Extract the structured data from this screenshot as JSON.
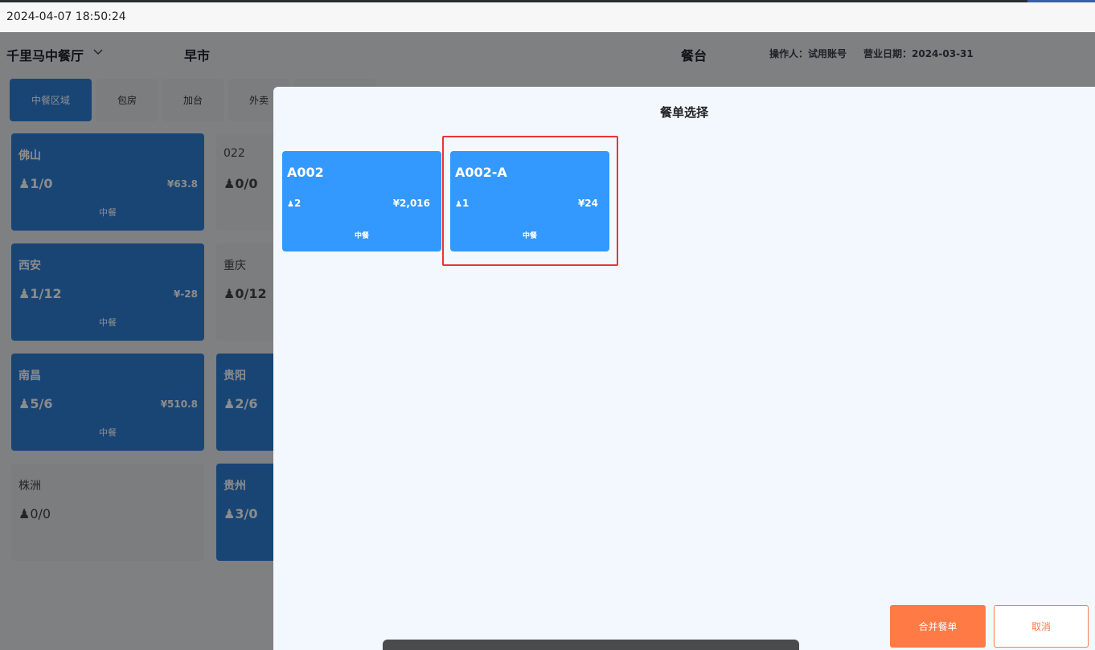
{
  "titlebar": {
    "datetime": "2024-04-07 18:50:24"
  },
  "header": {
    "restaurant": "千里马中餐厅",
    "shift": "早市",
    "section": "餐台",
    "operator": "操作人：试用账号",
    "business_date": "营业日期：2024-03-31"
  },
  "tabs": [
    {
      "label": "中餐区域",
      "active": true
    },
    {
      "label": "包房"
    },
    {
      "label": "加台"
    },
    {
      "label": "外卖"
    }
  ],
  "tables": [
    {
      "name": "佛山",
      "guests": "1/0",
      "amount": "¥63.8",
      "meal": "中餐",
      "status": "occupied"
    },
    {
      "name": "022",
      "guests": "0/0",
      "status": "free"
    },
    {
      "name": "西安",
      "guests": "1/12",
      "amount": "¥-28",
      "meal": "中餐",
      "status": "occupied"
    },
    {
      "name": "重庆",
      "guests": "0/12",
      "status": "free"
    },
    {
      "name": "南昌",
      "guests": "5/6",
      "amount": "¥510.8",
      "meal": "中餐",
      "status": "occupied"
    },
    {
      "name": "贵阳",
      "guests": "2/6",
      "status": "occupied"
    },
    {
      "name": "株洲",
      "guests": "0/0",
      "status": "free"
    },
    {
      "name": "贵州",
      "guests": "3/0",
      "status": "occupied"
    }
  ],
  "modal": {
    "title": "餐单选择",
    "orders": [
      {
        "no": "A002",
        "guests": "2",
        "amount": "¥2,016",
        "meal": "中餐"
      },
      {
        "no": "A002-A",
        "guests": "1",
        "amount": "¥24",
        "meal": "中餐",
        "highlighted": true
      }
    ],
    "merge_label": "合并餐单",
    "cancel_label": "取消"
  },
  "colors": {
    "primary": "#2e7fd6",
    "order_card": "#3399ff",
    "accent": "#ff7a45",
    "highlight": "#ee3333"
  }
}
